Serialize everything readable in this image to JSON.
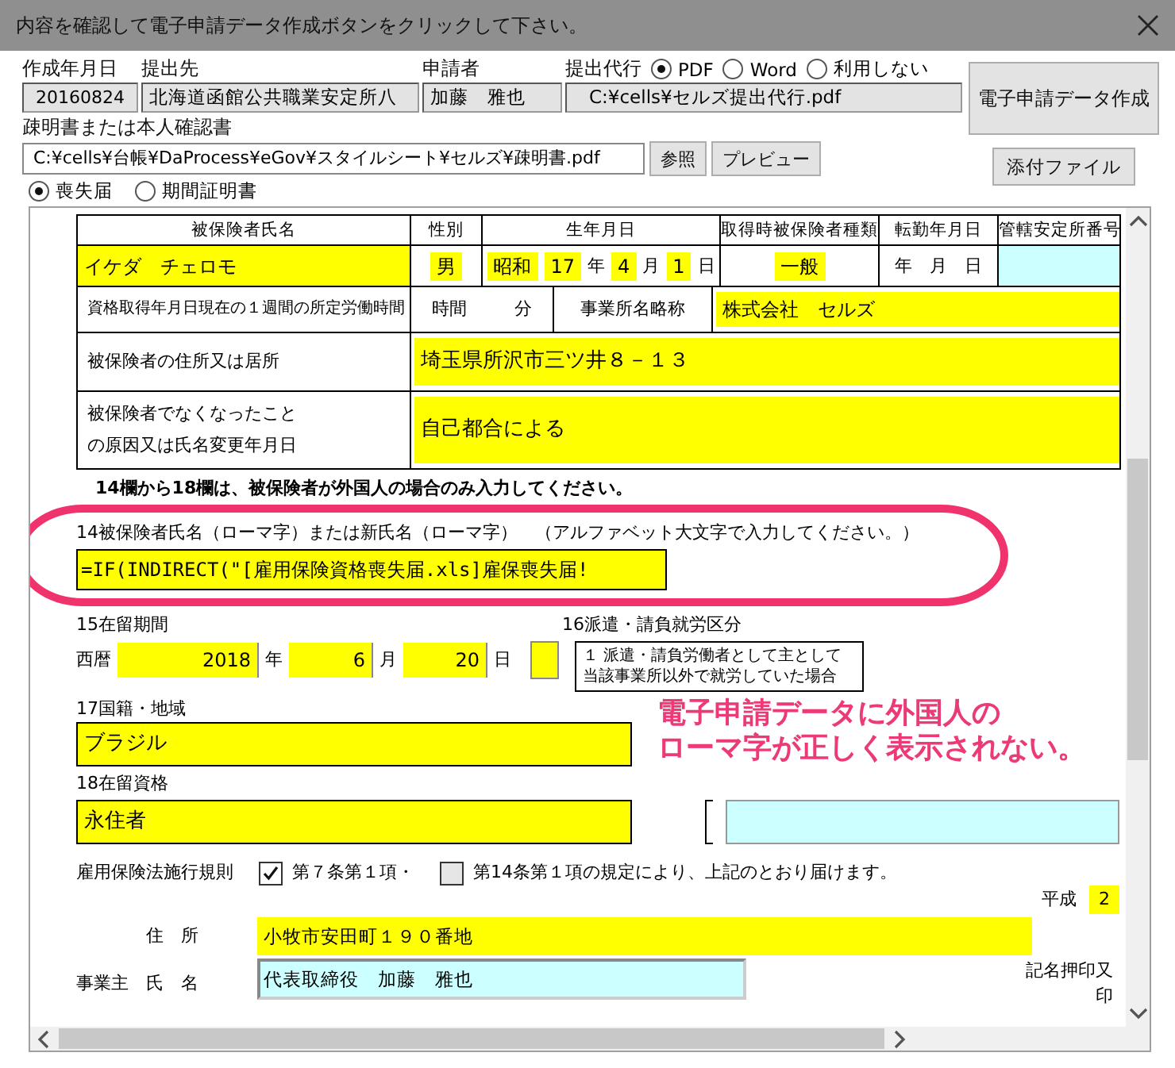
{
  "window": {
    "title": "内容を確認して電子申請データ作成ボタンをクリックして下さい。"
  },
  "header": {
    "date": {
      "label": "作成年月日",
      "value": "20160824"
    },
    "office": {
      "label": "提出先",
      "value": "北海道函館公共職業安定所八"
    },
    "applicant": {
      "label": "申請者",
      "value": "加藤　雅也"
    },
    "proxy": {
      "label": "提出代行",
      "options": [
        {
          "label": "PDF",
          "selected": true
        },
        {
          "label": "Word",
          "selected": false
        },
        {
          "label": "利用しない",
          "selected": false
        }
      ],
      "path": "C:¥cells¥セルズ提出代行.pdf"
    },
    "create_button": "電子申請データ作成",
    "document": {
      "label": "疎明書または本人確認書",
      "value": "C:¥cells¥台帳¥DaProcess¥eGov¥スタイルシート¥セルズ¥疎明書.pdf",
      "buttons": [
        "参照",
        "プレビュー"
      ]
    },
    "attach_button": "添付ファイル",
    "form_type": [
      {
        "label": "喪失届",
        "selected": true
      },
      {
        "label": "期間証明書",
        "selected": false
      }
    ]
  },
  "form": {
    "table": {
      "columns": [
        "被保険者氏名",
        "性別",
        "生年月日",
        "取得時被保険者種類",
        "転勤年月日",
        "管轄安定所番号"
      ],
      "rows": [
        {
          "cells": [
            [
              {
                "kind": "input",
                "text": "イケダ　チェロモ"
              }
            ],
            [
              {
                "kind": "input",
                "text": "男"
              }
            ],
            [
              {
                "kind": "input",
                "text": "昭和"
              },
              {
                "kind": "input",
                "text": "17"
              },
              {
                "kind": "text",
                "text": "年"
              },
              {
                "kind": "input",
                "text": "4"
              },
              {
                "kind": "text",
                "text": "月"
              },
              {
                "kind": "input",
                "text": "1"
              },
              {
                "kind": "text",
                "text": "日"
              }
            ],
            [
              {
                "kind": "input",
                "text": "一般"
              }
            ],
            [
              {
                "kind": "text",
                "text": "年　月　日"
              }
            ],
            [
              {
                "kind": "blank"
              }
            ]
          ]
        },
        {
          "cells": [
            [
              {
                "kind": "text",
                "text": "資格取得年月日現在の１週間の所定労働時間"
              }
            ],
            [
              {
                "kind": "text",
                "text": "時間"
              },
              {
                "kind": "text",
                "text": "分"
              }
            ],
            [
              {
                "kind": "text",
                "text": "事業所名略称"
              }
            ],
            [
              {
                "kind": "input",
                "text": "株式会社　セルズ"
              }
            ]
          ]
        },
        {
          "cells": [
            [
              {
                "kind": "text",
                "text": "被保険者の住所又は居所"
              }
            ],
            [
              {
                "kind": "input",
                "text": "埼玉県所沢市三ツ井８－１３"
              }
            ]
          ]
        },
        {
          "cells": [
            [
              {
                "kind": "text",
                "text": "被保険者でなくなったことの原因又は氏名変更年月日"
              }
            ],
            [
              {
                "kind": "input",
                "text": "自己都合による"
              }
            ]
          ]
        }
      ]
    },
    "foreigner": {
      "notice": "14欄から18欄は、被保険者が外国人の場合のみ入力してください。",
      "name_label": "14被保険者氏名（ローマ字）または新氏名（ローマ字）　（アルファベット大文字で入力してください。）",
      "name_value": "=IF(INDIRECT(\"[雇用保険資格喪失届.xls]雇保喪失届!",
      "period": {
        "label": "15在留期間",
        "parts": [
          {
            "kind": "text",
            "text": "西暦"
          },
          {
            "kind": "input",
            "text": "2018"
          },
          {
            "kind": "text",
            "text": "年"
          },
          {
            "kind": "input",
            "text": "6"
          },
          {
            "kind": "text",
            "text": "月"
          },
          {
            "kind": "input",
            "text": "20"
          },
          {
            "kind": "text",
            "text": "日"
          },
          {
            "kind": "input_empty"
          }
        ]
      },
      "dispatch": {
        "label": "16派遣・請負就労区分",
        "note": "１ 派遣・請負労働者として主として当該事業所以外で就労していた場合"
      },
      "nationality": {
        "label": "17国籍・地域",
        "value": "ブラジル"
      },
      "status": {
        "label": "18在留資格",
        "value": "永住者"
      }
    },
    "regulation": {
      "label": "雇用保険法施行規則",
      "options": [
        {
          "label": "第７条第１項・",
          "checked": true
        },
        {
          "label": "第14条第１項の規定により、上記のとおり届けます。",
          "checked": false
        }
      ]
    },
    "era": {
      "label": "平成",
      "value": "2"
    },
    "employer": {
      "label": "事業主",
      "address_label": "住　所",
      "address": "小牧市安田町１９０番地",
      "name_label": "氏　名",
      "name": "代表取締役　加藤　雅也",
      "seal_label": "記名押印又",
      "seal_mark": "印"
    }
  },
  "annotation": {
    "lines": [
      "電子申請データに外国人の",
      "ローマ字が正しく表示されない。"
    ]
  }
}
